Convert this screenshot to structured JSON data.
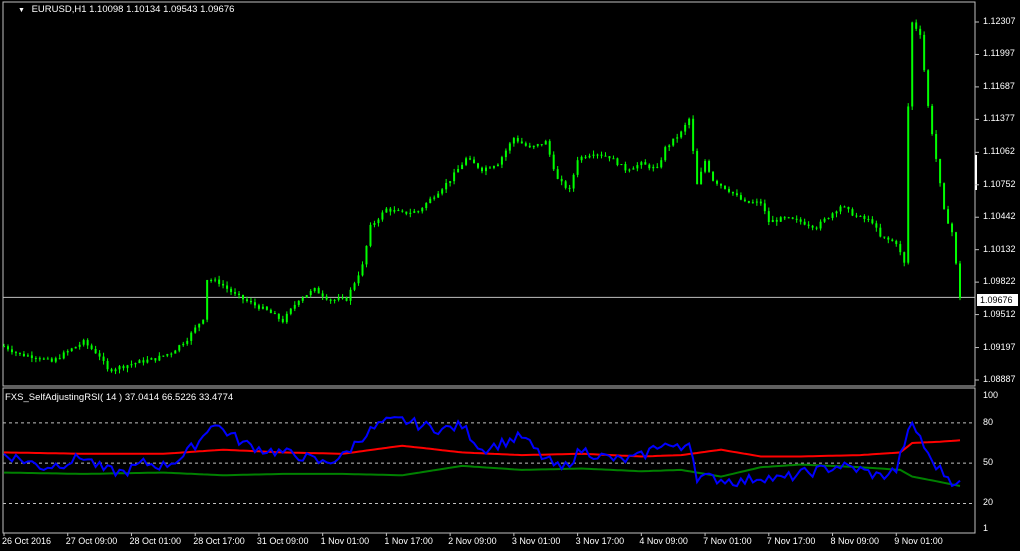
{
  "header": {
    "symbol": "EURUSD,H1",
    "ohlc": "1.10098 1.10134 1.09543 1.09676"
  },
  "indicator": {
    "title": "FXS_SelfAdjustingRSI( 14 ) 37.0414 66.5226 33.4774"
  },
  "price_box": "1.09676",
  "colors": {
    "background": "#000000",
    "candle": "#00ff00",
    "rsi_line": "#0000ff",
    "upper_band": "#ff0000",
    "lower_band": "#008000",
    "grid": "#c0c0c0",
    "current_price_line": "#c0c0c0"
  },
  "chart_data": [
    {
      "type": "line",
      "title": "EURUSD,H1",
      "y_ticks": [
        "1.12307",
        "1.11997",
        "1.11687",
        "1.11377",
        "1.11062",
        "1.10752",
        "1.10442",
        "1.10132",
        "1.09822",
        "1.09512",
        "1.09197",
        "1.08887"
      ],
      "ylim": [
        1.08887,
        1.12307
      ],
      "current_price": 1.09676,
      "x_ticks": [
        "26 Oct 2016",
        "27 Oct 09:00",
        "28 Oct 01:00",
        "28 Oct 17:00",
        "31 Oct 09:00",
        "1 Nov 01:00",
        "1 Nov 17:00",
        "2 Nov 09:00",
        "3 Nov 01:00",
        "3 Nov 17:00",
        "4 Nov 09:00",
        "7 Nov 01:00",
        "7 Nov 17:00",
        "8 Nov 09:00",
        "9 Nov 01:00"
      ],
      "x_tick_values": [
        0,
        16,
        32,
        48,
        64,
        80,
        96,
        112,
        128,
        144,
        160,
        176,
        192,
        208,
        224
      ],
      "close_series": [
        [
          0,
          1.0921
        ],
        [
          4,
          1.0913
        ],
        [
          8,
          1.0911
        ],
        [
          12,
          1.0906
        ],
        [
          16,
          1.0916
        ],
        [
          20,
          1.0925
        ],
        [
          24,
          1.0912
        ],
        [
          26,
          1.0898
        ],
        [
          30,
          1.0902
        ],
        [
          34,
          1.0906
        ],
        [
          38,
          1.0909
        ],
        [
          42,
          1.0915
        ],
        [
          46,
          1.0928
        ],
        [
          50,
          1.0948
        ],
        [
          51,
          1.0985
        ],
        [
          54,
          1.0982
        ],
        [
          58,
          1.097
        ],
        [
          62,
          1.0962
        ],
        [
          66,
          1.0955
        ],
        [
          70,
          1.0945
        ],
        [
          74,
          1.0966
        ],
        [
          78,
          1.0975
        ],
        [
          82,
          1.0965
        ],
        [
          86,
          1.0966
        ],
        [
          90,
          1.0998
        ],
        [
          92,
          1.1035
        ],
        [
          96,
          1.1052
        ],
        [
          100,
          1.1048
        ],
        [
          104,
          1.105
        ],
        [
          108,
          1.1065
        ],
        [
          112,
          1.108
        ],
        [
          116,
          1.11
        ],
        [
          120,
          1.109
        ],
        [
          124,
          1.1096
        ],
        [
          128,
          1.112
        ],
        [
          132,
          1.111
        ],
        [
          136,
          1.1116
        ],
        [
          139,
          1.108
        ],
        [
          142,
          1.107
        ],
        [
          144,
          1.11
        ],
        [
          148,
          1.1106
        ],
        [
          152,
          1.1102
        ],
        [
          156,
          1.109
        ],
        [
          160,
          1.1095
        ],
        [
          164,
          1.109
        ],
        [
          166,
          1.111
        ],
        [
          170,
          1.1125
        ],
        [
          172,
          1.1138
        ],
        [
          174,
          1.1075
        ],
        [
          176,
          1.1098
        ],
        [
          178,
          1.108
        ],
        [
          182,
          1.107
        ],
        [
          186,
          1.1058
        ],
        [
          190,
          1.1058
        ],
        [
          192,
          1.104
        ],
        [
          196,
          1.1043
        ],
        [
          200,
          1.104
        ],
        [
          204,
          1.1035
        ],
        [
          207,
          1.1045
        ],
        [
          210,
          1.1055
        ],
        [
          214,
          1.1045
        ],
        [
          218,
          1.104
        ],
        [
          220,
          1.1025
        ],
        [
          224,
          1.102
        ],
        [
          226,
          1.1
        ],
        [
          227,
          1.115
        ],
        [
          228,
          1.123
        ],
        [
          230,
          1.122
        ],
        [
          232,
          1.115
        ],
        [
          234,
          1.11
        ],
        [
          236,
          1.105
        ],
        [
          238,
          1.103
        ],
        [
          240,
          1.0968
        ]
      ]
    },
    {
      "type": "line",
      "title": "FXS_SelfAdjustingRSI( 14 ) 37.0414 66.5226 33.4774",
      "y_ticks": [
        "100",
        "80",
        "50",
        "20",
        "1"
      ],
      "levels": [
        80,
        50,
        20
      ],
      "ylim": [
        1,
        100
      ],
      "series": [
        {
          "values": [
            [
              0,
              57
            ],
            [
              5,
              52
            ],
            [
              10,
              47
            ],
            [
              15,
              50
            ],
            [
              20,
              55
            ],
            [
              25,
              45
            ],
            [
              30,
              43
            ],
            [
              35,
              50
            ],
            [
              40,
              48
            ],
            [
              45,
              55
            ],
            [
              50,
              70
            ],
            [
              52,
              80
            ],
            [
              55,
              75
            ],
            [
              60,
              65
            ],
            [
              65,
              60
            ],
            [
              70,
              58
            ],
            [
              75,
              55
            ],
            [
              80,
              50
            ],
            [
              85,
              55
            ],
            [
              90,
              70
            ],
            [
              95,
              80
            ],
            [
              100,
              82
            ],
            [
              105,
              78
            ],
            [
              110,
              75
            ],
            [
              115,
              78
            ],
            [
              120,
              60
            ],
            [
              125,
              65
            ],
            [
              130,
              70
            ],
            [
              135,
              55
            ],
            [
              140,
              45
            ],
            [
              145,
              60
            ],
            [
              150,
              55
            ],
            [
              155,
              52
            ],
            [
              160,
              55
            ],
            [
              165,
              65
            ],
            [
              170,
              60
            ],
            [
              172,
              68
            ],
            [
              174,
              40
            ],
            [
              180,
              38
            ],
            [
              185,
              36
            ],
            [
              190,
              40
            ],
            [
              195,
              38
            ],
            [
              200,
              42
            ],
            [
              205,
              45
            ],
            [
              210,
              48
            ],
            [
              215,
              45
            ],
            [
              220,
              40
            ],
            [
              224,
              45
            ],
            [
              226,
              65
            ],
            [
              228,
              78
            ],
            [
              230,
              70
            ],
            [
              232,
              55
            ],
            [
              235,
              45
            ],
            [
              238,
              37
            ],
            [
              240,
              37
            ]
          ]
        },
        {
          "values": [
            [
              0,
              58
            ],
            [
              20,
              57
            ],
            [
              40,
              57
            ],
            [
              55,
              60
            ],
            [
              70,
              58
            ],
            [
              85,
              57
            ],
            [
              100,
              63
            ],
            [
              115,
              58
            ],
            [
              130,
              56
            ],
            [
              145,
              57
            ],
            [
              160,
              55
            ],
            [
              170,
              56
            ],
            [
              180,
              60
            ],
            [
              190,
              55
            ],
            [
              200,
              55
            ],
            [
              215,
              56
            ],
            [
              225,
              58
            ],
            [
              228,
              65
            ],
            [
              235,
              66
            ],
            [
              240,
              67
            ]
          ]
        },
        {
          "values": [
            [
              0,
              43
            ],
            [
              20,
              42
            ],
            [
              40,
              43
            ],
            [
              55,
              41
            ],
            [
              70,
              42
            ],
            [
              85,
              42
            ],
            [
              100,
              41
            ],
            [
              115,
              48
            ],
            [
              130,
              45
            ],
            [
              145,
              46
            ],
            [
              160,
              44
            ],
            [
              170,
              45
            ],
            [
              180,
              40
            ],
            [
              190,
              47
            ],
            [
              200,
              49
            ],
            [
              215,
              47
            ],
            [
              225,
              45
            ],
            [
              228,
              40
            ],
            [
              235,
              36
            ],
            [
              240,
              33
            ]
          ]
        }
      ]
    }
  ]
}
